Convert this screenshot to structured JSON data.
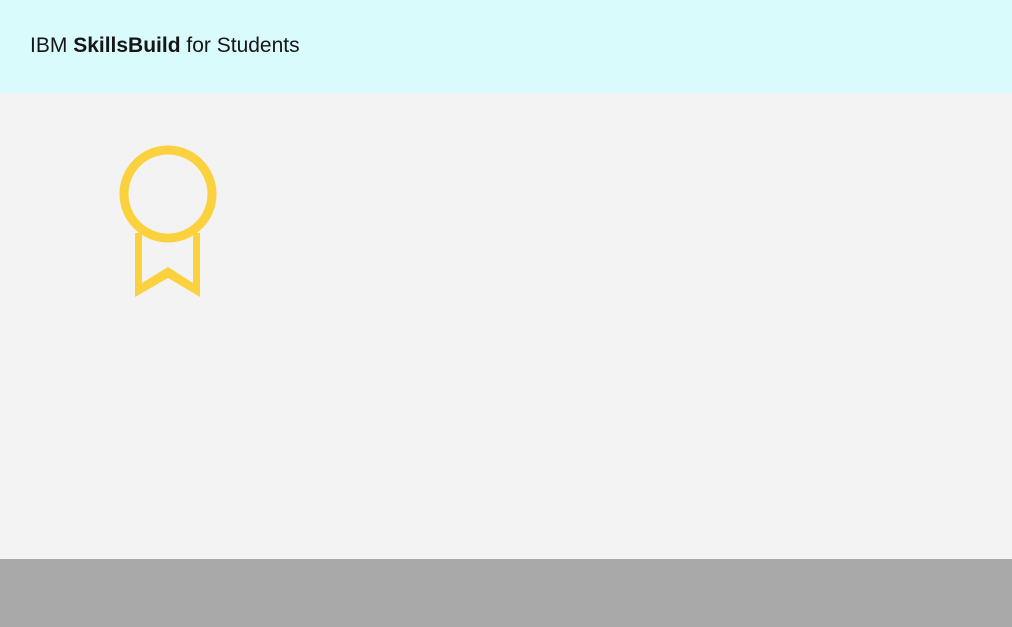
{
  "header": {
    "brand_prefix": "IBM",
    "brand_bold": "SkillsBuild",
    "brand_suffix": "for Students"
  },
  "badge": {
    "icon": "award-ribbon-icon",
    "color": "#fcd13e"
  },
  "colors": {
    "header_bg": "#d9fbfb",
    "main_bg": "#f3f3f3",
    "footer_bg": "#a8a8a8"
  }
}
